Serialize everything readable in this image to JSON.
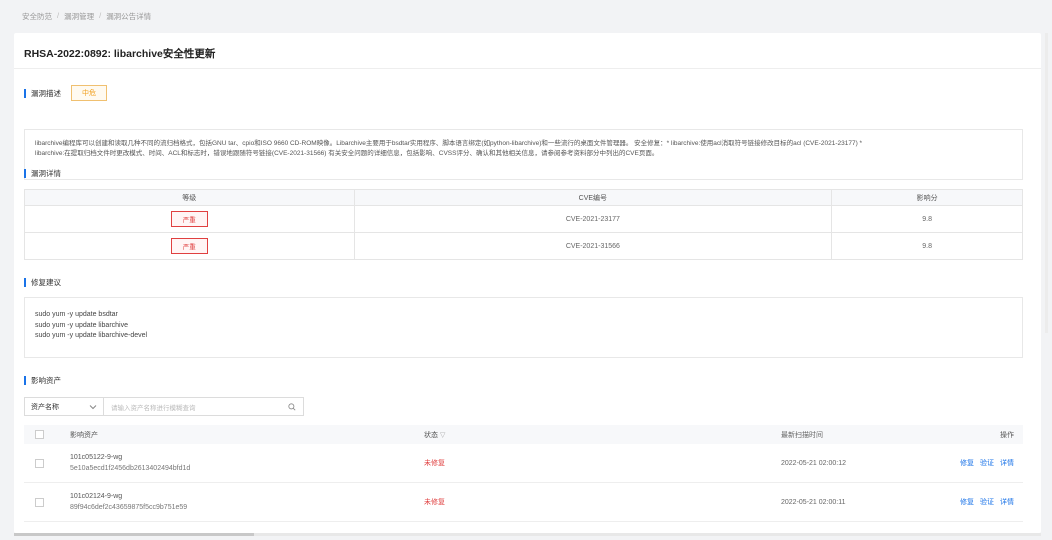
{
  "breadcrumb": [
    "安全防范",
    "漏洞管理",
    "漏洞公告详情"
  ],
  "title": "RHSA-2022:0892: libarchive安全性更新",
  "sections": {
    "desc": "漏洞描述",
    "detail": "漏洞详情",
    "fix": "修复建议",
    "assets": "影响资产"
  },
  "severity_label": "中危",
  "description_line1": "libarchive编程库可以创建和读取几种不同的流归档格式，包括GNU tar、cpio和ISO 9660 CD-ROM映像。Libarchive主要用于bsdtar实用程序、脚本语言绑定(如python-libarchive)和一些流行的桌面文件管理器。 安全修复：* libarchive:使用acl消取符号链接修改目标的acl (CVE-2021-23177) *",
  "description_line2": "libarchive:在提取归档文件时更改模式、时间、ACL和标志时，错误地跟随符号链接(CVE-2021-31566) 有关安全问题的详细信息，包括影响、CVSS评分、确认和其他相关信息，请参阅参考资料部分中列出的CVE页面。",
  "detail_table": {
    "headers": [
      "等级",
      "CVE编号",
      "影响分"
    ],
    "rows": [
      {
        "level": "严重",
        "cve": "CVE-2021-23177",
        "score": "9.8"
      },
      {
        "level": "严重",
        "cve": "CVE-2021-31566",
        "score": "9.8"
      }
    ]
  },
  "fix_commands": [
    "sudo yum -y update bsdtar",
    "sudo yum -y update libarchive",
    "sudo yum -y update libarchive-devel"
  ],
  "filter": {
    "select_value": "资产名称",
    "placeholder": "请输入资产名称进行模糊查询"
  },
  "asset_table": {
    "headers": {
      "asset": "影响资产",
      "status": "状态",
      "time": "最新扫描时间",
      "op": "操作"
    },
    "rows": [
      {
        "name": "101c05122-9-wg",
        "id": "5e10a5ecd1f2456db2613402494bfd1d",
        "status": "未修复",
        "time": "2022-05-21 02:00:12"
      },
      {
        "name": "101c02124-9-wg",
        "id": "89f94c6def2c43659875f5cc9b751e59",
        "status": "未修复",
        "time": "2022-05-21 02:00:11"
      }
    ],
    "ops": [
      "修复",
      "验证",
      "详情"
    ]
  },
  "colors": {
    "accent": "#1a73e8",
    "danger": "#e04040",
    "warning": "#f0a020"
  }
}
